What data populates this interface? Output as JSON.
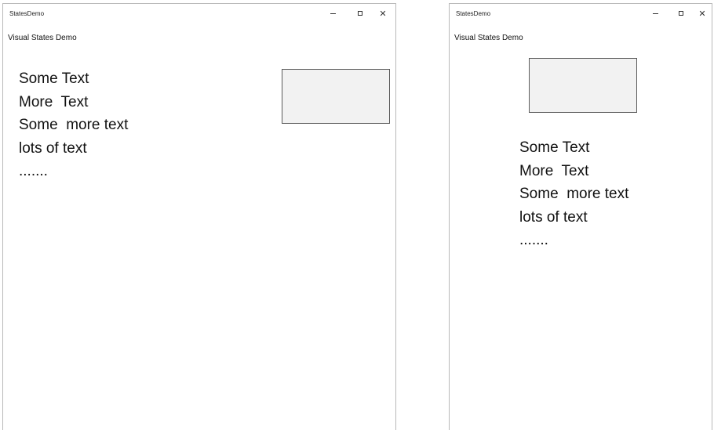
{
  "windows": [
    {
      "app_title": "StatesDemo",
      "page_header": "Visual States Demo",
      "text_lines": [
        "Some Text",
        "More  Text",
        "Some  more text",
        "lots of text",
        "......."
      ]
    },
    {
      "app_title": "StatesDemo",
      "page_header": "Visual States Demo",
      "text_lines": [
        "Some Text",
        "More  Text",
        "Some  more text",
        "lots of text",
        "......."
      ]
    }
  ],
  "caption_buttons": {
    "close_glyph": "✕"
  },
  "icons": {
    "minimize": "minimize-icon",
    "maximize": "maximize-icon",
    "close": "close-icon"
  },
  "colors": {
    "box_fill": "#f2f2f2",
    "box_border": "#5a5a5a",
    "window_border": "#b9b9b9"
  }
}
